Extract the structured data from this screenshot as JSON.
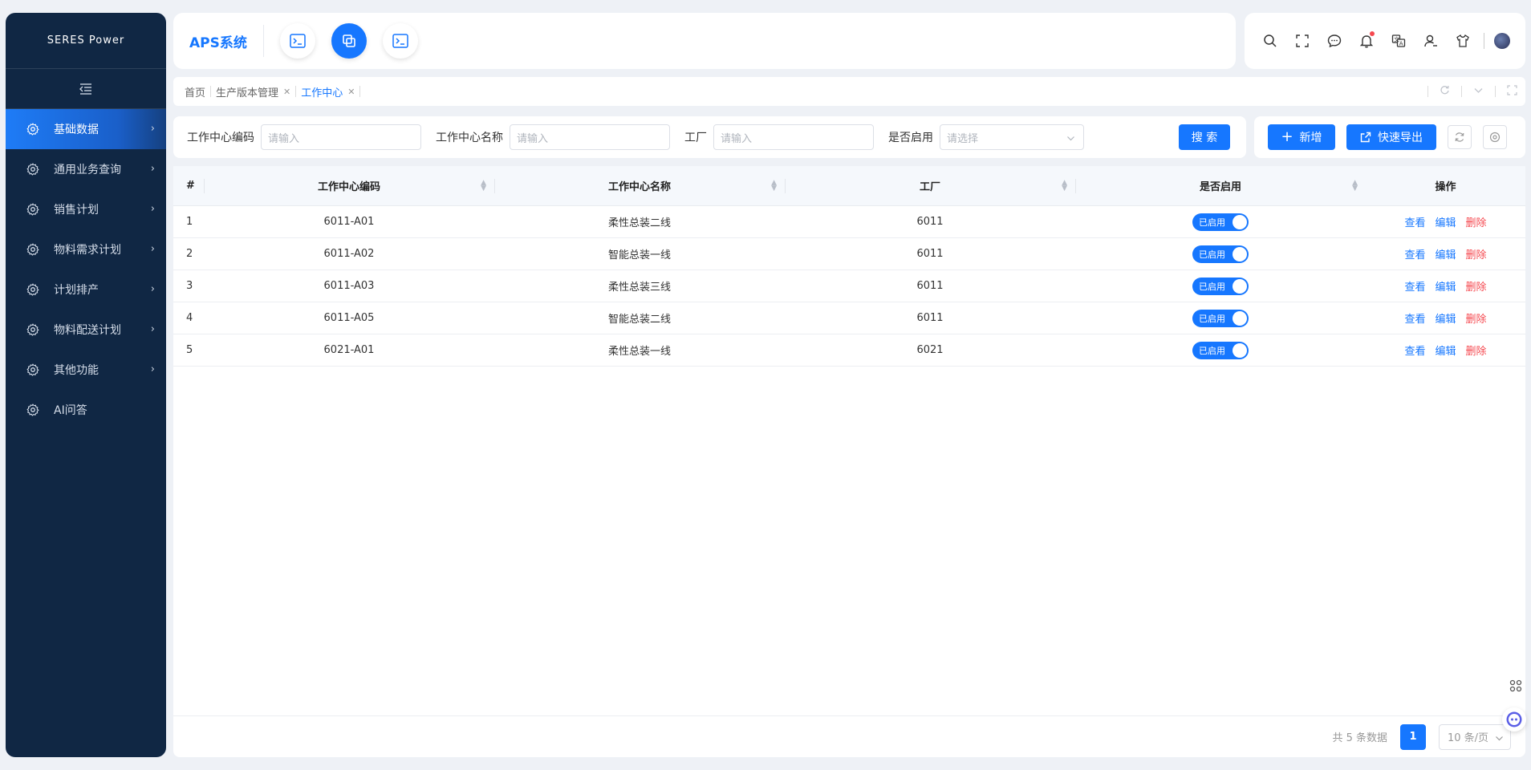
{
  "brand": "SERES Power",
  "app_title": "APS系统",
  "sidebar": {
    "items": [
      {
        "label": "基础数据",
        "active": true,
        "has_arrow": true
      },
      {
        "label": "通用业务查询",
        "has_arrow": true
      },
      {
        "label": "销售计划",
        "has_arrow": true
      },
      {
        "label": "物料需求计划",
        "has_arrow": true
      },
      {
        "label": "计划排产",
        "has_arrow": true
      },
      {
        "label": "物料配送计划",
        "has_arrow": true
      },
      {
        "label": "其他功能",
        "has_arrow": true
      },
      {
        "label": "AI问答",
        "has_arrow": false
      }
    ]
  },
  "breadcrumbs": [
    {
      "label": "首页",
      "closable": false
    },
    {
      "label": "生产版本管理",
      "closable": true
    },
    {
      "label": "工作中心",
      "closable": true,
      "active": true
    }
  ],
  "filters": {
    "code_label": "工作中心编码",
    "code_placeholder": "请输入",
    "name_label": "工作中心名称",
    "name_placeholder": "请输入",
    "plant_label": "工厂",
    "plant_placeholder": "请输入",
    "enabled_label": "是否启用",
    "enabled_placeholder": "请选择",
    "search_label": "搜 索"
  },
  "actions": {
    "add_label": "新增",
    "export_label": "快速导出"
  },
  "table": {
    "headers": {
      "index": "#",
      "code": "工作中心编码",
      "name": "工作中心名称",
      "plant": "工厂",
      "enabled": "是否启用",
      "ops": "操作"
    },
    "ops": {
      "view": "查看",
      "edit": "编辑",
      "delete": "删除"
    },
    "status_label": "已启用",
    "rows": [
      {
        "index": "1",
        "code": "6011-A01",
        "name": "柔性总装二线",
        "plant": "6011"
      },
      {
        "index": "2",
        "code": "6011-A02",
        "name": "智能总装一线",
        "plant": "6011"
      },
      {
        "index": "3",
        "code": "6011-A03",
        "name": "柔性总装三线",
        "plant": "6011"
      },
      {
        "index": "4",
        "code": "6011-A05",
        "name": "智能总装二线",
        "plant": "6011"
      },
      {
        "index": "5",
        "code": "6021-A01",
        "name": "柔性总装一线",
        "plant": "6021"
      }
    ]
  },
  "pagination": {
    "total_text": "共 5 条数据",
    "current_page": "1",
    "page_size": "10 条/页"
  },
  "colors": {
    "accent": "#1677ff",
    "sidebar_bg": "#102744",
    "danger": "#f5484f"
  }
}
